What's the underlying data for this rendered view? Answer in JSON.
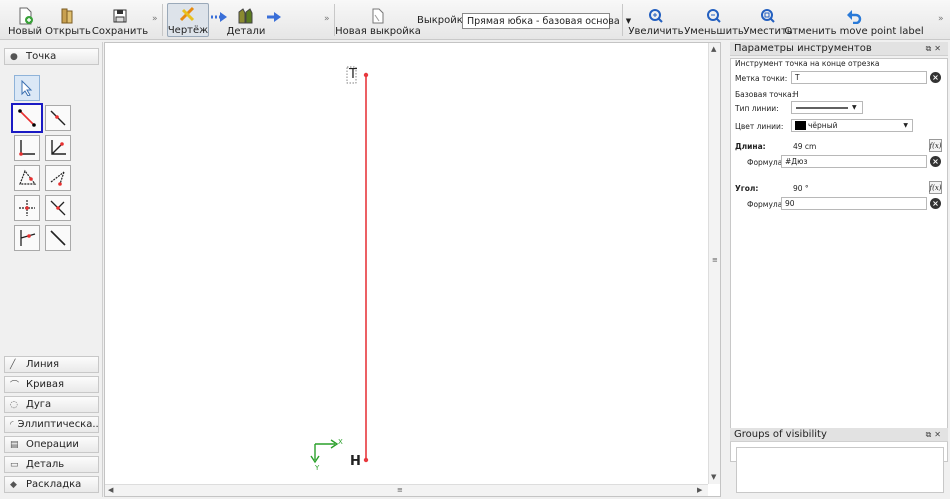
{
  "toolbar": {
    "new_label": "Новый",
    "open_label": "Открыть",
    "save_label": "Сохранить",
    "draw_label": "Чертёж",
    "details_label": "Детали",
    "new_pattern_label": "Новая выкройка",
    "pattern_label": "Выкройка:",
    "pattern_value": "Прямая юбка - базовая основа",
    "zoom_in_label": "Увеличить",
    "zoom_out_label": "Уменьшить",
    "fit_label": "Уместить",
    "undo_label": "Отменить move point label",
    "more": "»"
  },
  "left_panel": {
    "top_group": "Точка",
    "groups": [
      "Линия",
      "Кривая",
      "Дуга",
      "Эллиптическа...",
      "Операции",
      "Деталь",
      "Раскладка"
    ]
  },
  "canvas": {
    "point_top": "T",
    "point_bottom": "H",
    "axis_x": "X",
    "axis_y": "Y"
  },
  "tool_options": {
    "title": "Параметры инструментов",
    "subtitle": "Инструмент точка на конце отрезка",
    "point_label_caption": "Метка точки:",
    "point_label_value": "T",
    "base_point_caption": "Базовая точка:",
    "base_point_value": "H",
    "line_type_caption": "Тип линии:",
    "line_color_caption": "Цвет линии:",
    "line_color_value": "чёрный",
    "length_caption": "Длина:",
    "length_value": "49 cm",
    "length_formula_caption": "Формула",
    "length_formula_value": "#Дюз",
    "angle_caption": "Угол:",
    "angle_value": "90 °",
    "angle_formula_caption": "Формула",
    "angle_formula_value": "90",
    "fx": "f(x)"
  },
  "visibility": {
    "title": "Groups of visibility"
  },
  "colors": {
    "line": "#e8383d",
    "accent": "#1a1ac4",
    "axis": "#2aa02a"
  }
}
